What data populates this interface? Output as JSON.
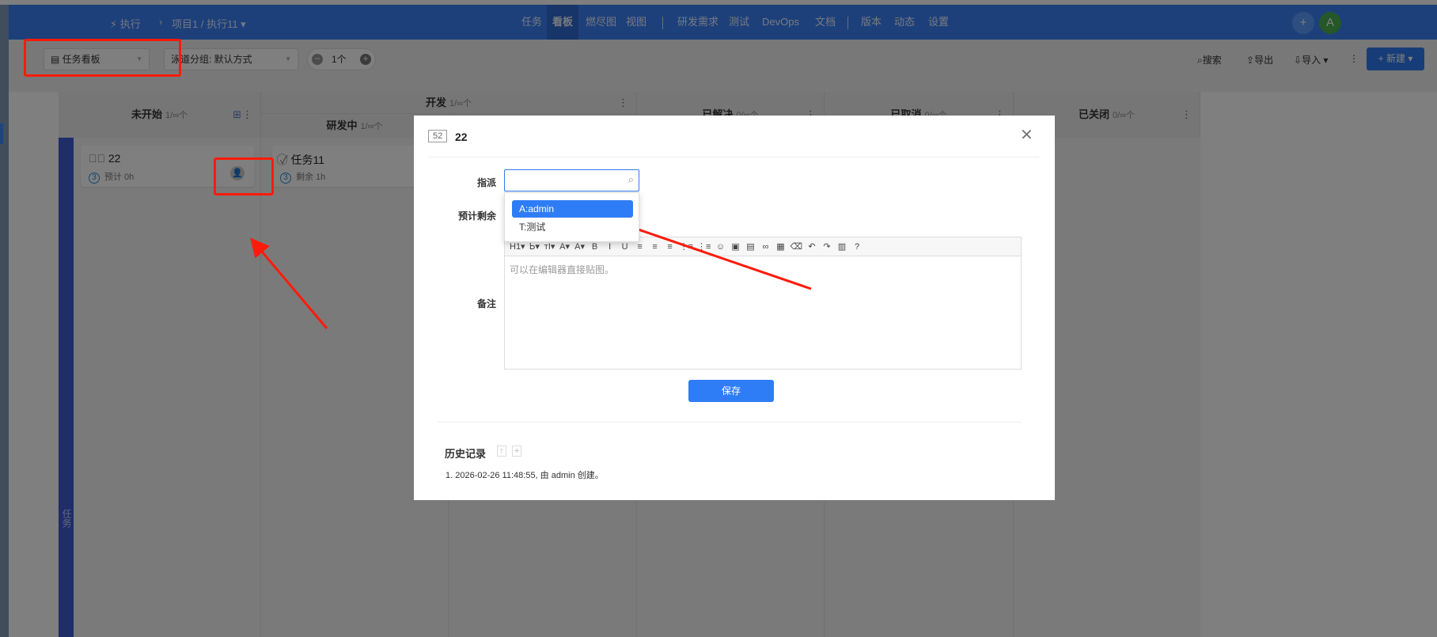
{
  "topbar": {
    "breadcrumb": {
      "section": "执行",
      "path": "项目1 / 执行11"
    },
    "nav": [
      "任务",
      "看板",
      "燃尽图",
      "视图",
      "研发需求",
      "测试",
      "DevOps",
      "文档",
      "版本",
      "动态",
      "设置"
    ],
    "active_nav": "看板",
    "avatar_letter": "A",
    "colors": {
      "bar": "#3a80f6",
      "avatar": "#4caf50"
    }
  },
  "toolbar": {
    "view_select": "任务看板",
    "lane_group": "泳道分组: 默认方式",
    "count": "1个",
    "search": "搜索",
    "export": "导出",
    "import": "导入",
    "new": "新建"
  },
  "board": {
    "columns": [
      {
        "name": "未开始",
        "count": "1/∞个"
      },
      {
        "name": "开发",
        "count": "1/∞个"
      },
      {
        "name": "已解决",
        "count": "0/∞个"
      },
      {
        "name": "已取消",
        "count": "0/∞个"
      },
      {
        "name": "已关闭",
        "count": "0/∞个"
      }
    ],
    "subcolumns": [
      {
        "name": "研发中",
        "count": "1/∞个"
      }
    ],
    "lane": "任务",
    "cards": [
      {
        "title": "22",
        "priority": "3",
        "meta": "预计 0h"
      },
      {
        "title": "任务11",
        "priority": "3",
        "meta": "剩余 1h"
      }
    ]
  },
  "modal": {
    "id": "52",
    "title": "22",
    "assign_label": "指派",
    "assign_value": "",
    "options": [
      "A:admin",
      "T:测试"
    ],
    "remaining_label": "预计剩余",
    "remark_label": "备注",
    "editor_placeholder": "可以在编辑器直接贴图。",
    "editor_tools": [
      "H1▾",
      "Ꮟ▾",
      "ᴛI▾",
      "A▾",
      "A▾",
      "B",
      "I",
      "U",
      "≡",
      "≡",
      "≡",
      "⋮≡",
      "⋮≡",
      "☺",
      "▣",
      "▤",
      "∞",
      "▦",
      "⌫",
      "↶",
      "↷",
      "▥",
      "?"
    ],
    "save": "保存",
    "history_title": "历史记录",
    "history": [
      "1. 2026-02-26 11:48:55, 由 admin 创建。"
    ]
  }
}
